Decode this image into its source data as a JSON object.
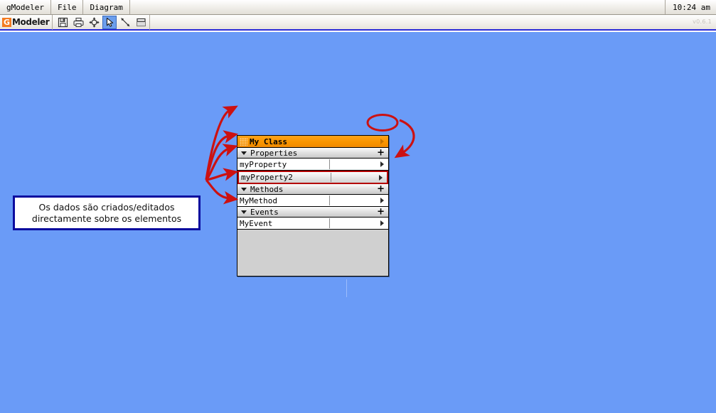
{
  "window": {
    "title": "gModeler",
    "clock": "10:24 am",
    "version": "v0.6.1"
  },
  "menubar": {
    "items": [
      {
        "label": "gModeler",
        "name": "menu-gmodeler"
      },
      {
        "label": "File",
        "name": "menu-file"
      },
      {
        "label": "Diagram",
        "name": "menu-diagram"
      }
    ]
  },
  "toolbar": {
    "logo_badge": "G",
    "logo_text": "Modeler",
    "buttons": [
      {
        "icon": "save-icon",
        "label": "Save",
        "active": false
      },
      {
        "icon": "print-icon",
        "label": "Print",
        "active": false
      },
      {
        "icon": "pan-icon",
        "label": "Pan",
        "active": false
      },
      {
        "icon": "select-arrow-icon",
        "label": "Select",
        "active": true
      },
      {
        "icon": "connector-line-icon",
        "label": "Connector",
        "active": false
      },
      {
        "icon": "class-shape-icon",
        "label": "Class",
        "active": false
      }
    ]
  },
  "canvas": {
    "background_color": "#6a9bf7"
  },
  "class_box": {
    "title": "My Class",
    "header_color": "#f99500",
    "sections": [
      {
        "label": "Properties",
        "add_label": "+",
        "items": [
          {
            "name": "myProperty",
            "value": "",
            "selected": false
          },
          {
            "name": "myProperty2",
            "value": "",
            "selected": true
          }
        ]
      },
      {
        "label": "Methods",
        "add_label": "+",
        "items": [
          {
            "name": "MyMethod",
            "value": "",
            "selected": false
          }
        ]
      },
      {
        "label": "Events",
        "add_label": "+",
        "items": [
          {
            "name": "MyEvent",
            "value": "",
            "selected": false
          }
        ]
      }
    ]
  },
  "callout": {
    "line1": "Os dados são criados/editados",
    "line2": "directamente sobre os elementos",
    "border_color": "#0b0b9e"
  },
  "annotations": {
    "arrow_color": "#cc1111",
    "highlight_shape": "ellipse",
    "highlight_target": "add-property-button"
  }
}
